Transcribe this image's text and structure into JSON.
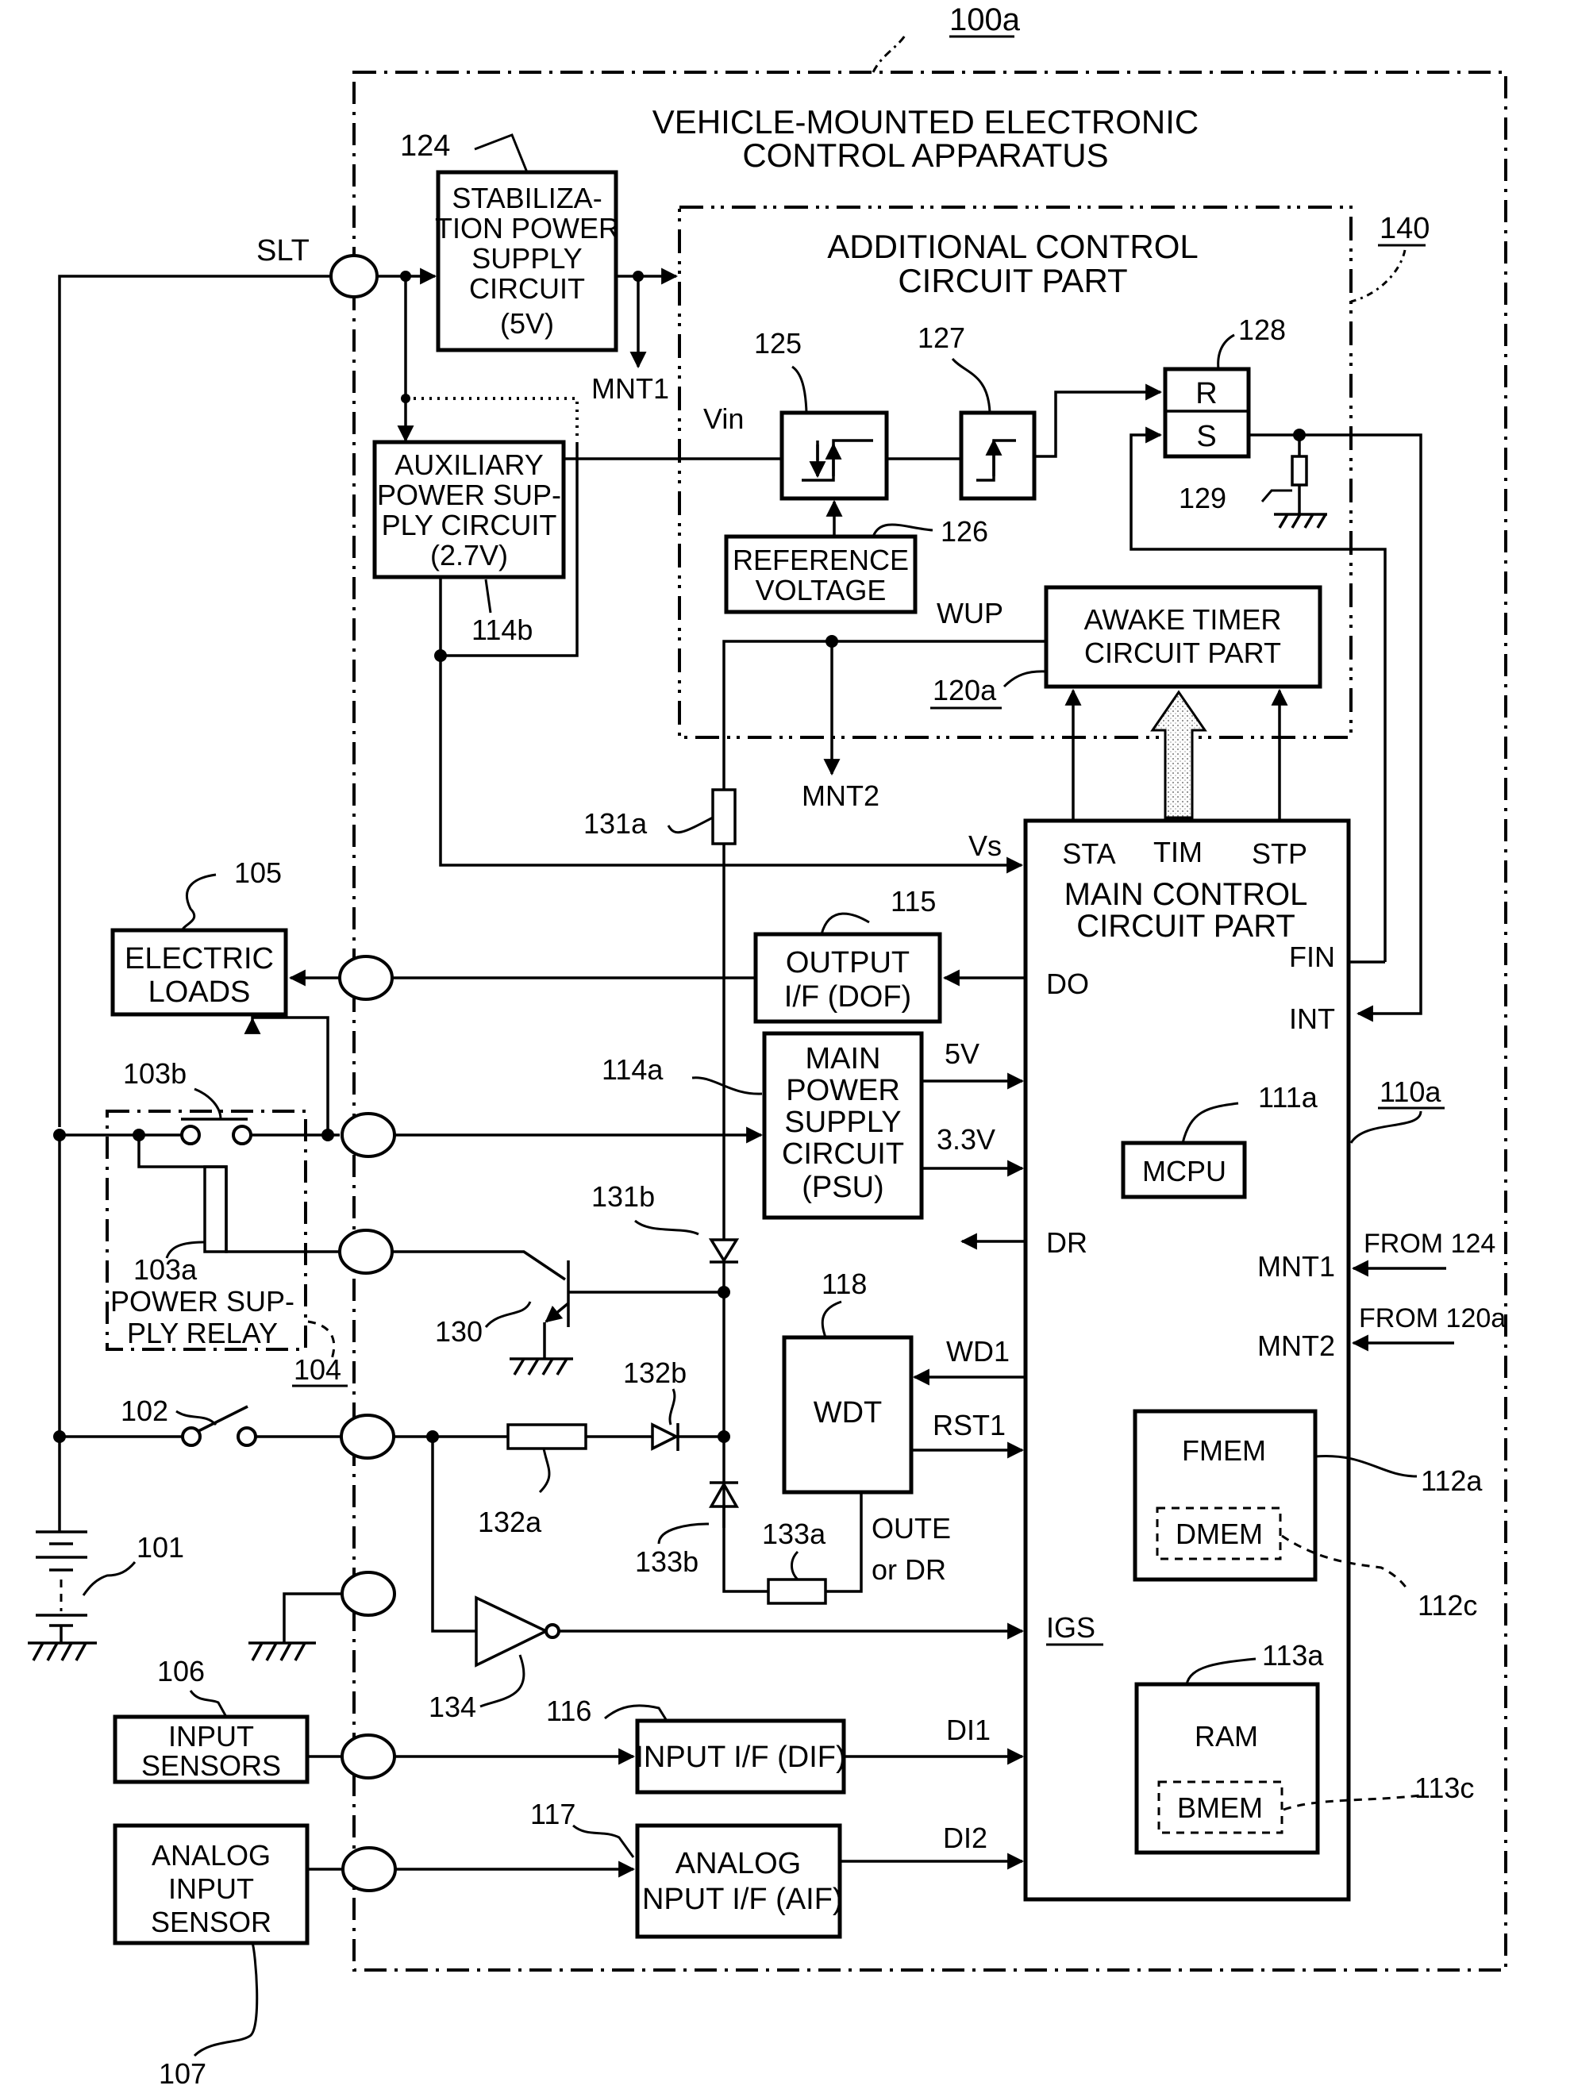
{
  "figure": {
    "ref": "100a",
    "title_line1": "VEHICLE-MOUNTED ELECTRONIC",
    "title_line2": "CONTROL APPARATUS"
  },
  "blocks": {
    "stabilization": {
      "ref": "124",
      "lines": [
        "STABILIZA-",
        "TION POWER",
        "SUPPLY",
        "CIRCUIT",
        "(5V)"
      ]
    },
    "auxiliary": {
      "ref": "114b",
      "lines": [
        "AUXILIARY",
        "POWER SUP-",
        "PLY CIRCUIT",
        "(2.7V)"
      ]
    },
    "additional_control": {
      "ref": "140",
      "lines": [
        "ADDITIONAL CONTROL",
        "CIRCUIT PART"
      ]
    },
    "comparator": {
      "ref": "125"
    },
    "edge_detector": {
      "ref": "127"
    },
    "flipflop": {
      "ref": "128",
      "r_label": "R",
      "s_label": "S"
    },
    "pulldown_resistor": {
      "ref": "129"
    },
    "reference_voltage": {
      "ref": "126",
      "lines": [
        "REFERENCE",
        "VOLTAGE"
      ]
    },
    "awake_timer": {
      "ref": "120a",
      "lines": [
        "AWAKE TIMER",
        "CIRCUIT PART"
      ]
    },
    "main_control": {
      "ref": "110a",
      "lines": [
        "MAIN CONTROL",
        "CIRCUIT PART"
      ],
      "pins": {
        "sta": "STA",
        "tim": "TIM",
        "stp": "STP",
        "fin": "FIN",
        "int": "INT",
        "do": "DO",
        "dr": "DR",
        "mnt1": "MNT1",
        "mnt2": "MNT2",
        "igs": "IGS"
      }
    },
    "mcpu": {
      "ref": "111a",
      "label": "MCPU"
    },
    "fmem": {
      "ref": "112a",
      "label": "FMEM"
    },
    "dmem": {
      "ref": "112c",
      "label": "DMEM"
    },
    "ram": {
      "ref": "113a",
      "label": "RAM"
    },
    "bmem": {
      "ref": "113c",
      "label": "BMEM"
    },
    "output_if": {
      "ref": "115",
      "lines": [
        "OUTPUT",
        "I/F (DOF)"
      ]
    },
    "main_psu": {
      "ref": "114a",
      "lines": [
        "MAIN",
        "POWER",
        "SUPPLY",
        "CIRCUIT",
        "(PSU)"
      ]
    },
    "wdt": {
      "ref": "118",
      "label": "WDT"
    },
    "input_if": {
      "ref": "116",
      "label": "INPUT I/F (DIF)"
    },
    "analog_if": {
      "ref": "117",
      "lines": [
        "ANALOG",
        "INPUT I/F (AIF)"
      ]
    },
    "electric_loads": {
      "ref": "105",
      "lines": [
        "ELECTRIC",
        "LOADS"
      ]
    },
    "relay": {
      "ref": "104",
      "coil_ref": "103a",
      "contact_ref": "103b",
      "lines": [
        "POWER SUP-",
        "PLY RELAY"
      ]
    },
    "input_sensors": {
      "ref": "106",
      "lines": [
        "INPUT",
        "SENSORS"
      ]
    },
    "analog_sensor": {
      "ref": "107",
      "lines": [
        "ANALOG",
        "INPUT",
        "SENSOR"
      ]
    },
    "battery": {
      "ref": "101"
    },
    "power_switch": {
      "ref": "102"
    },
    "transistor": {
      "ref": "130"
    },
    "resistor_131a": {
      "ref": "131a"
    },
    "diode_131b": {
      "ref": "131b"
    },
    "resistor_132a": {
      "ref": "132a"
    },
    "diode_132b": {
      "ref": "132b"
    },
    "resistor_133a": {
      "ref": "133a"
    },
    "diode_133b": {
      "ref": "133b"
    },
    "inverter": {
      "ref": "134"
    }
  },
  "signals": {
    "slt": "SLT",
    "mnt1": "MNT1",
    "mnt2": "MNT2",
    "vin": "Vin",
    "wup": "WUP",
    "vs": "Vs",
    "v5": "5V",
    "v33": "3.3V",
    "wd1": "WD1",
    "rst1": "RST1",
    "oute_line1": "OUTE",
    "oute_line2": "or DR",
    "di1": "DI1",
    "di2": "DI2",
    "from124": "FROM 124",
    "from120a": "FROM 120a"
  }
}
